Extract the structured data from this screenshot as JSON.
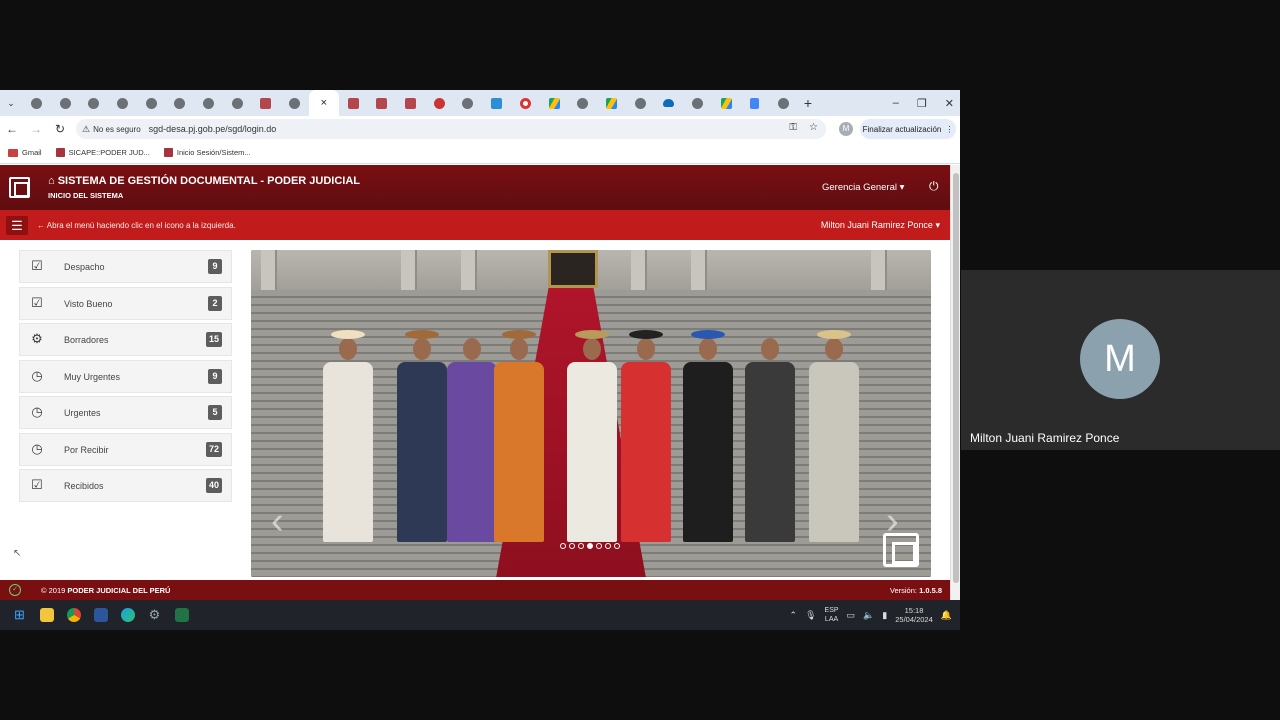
{
  "browser": {
    "tab_count": 27,
    "active_tab_index": 10,
    "active_tab_close": "×",
    "new_tab": "+",
    "window_controls": {
      "minimize": "–",
      "restore": "❐",
      "close": "✕"
    },
    "nav": {
      "back": "←",
      "forward": "→",
      "reload": "↻"
    },
    "address": {
      "security_label": "No es seguro",
      "url": "sgd-desa.pj.gob.pe/sgd/login.do"
    },
    "profile_initial": "M",
    "update_button": "Finalizar actualización",
    "bookmarks": [
      {
        "label": "Gmail",
        "icon": "gmail-icon"
      },
      {
        "label": "SICAPE::PODER JUD...",
        "icon": "pj-icon"
      },
      {
        "label": "Inicio Sesión/Sistem...",
        "icon": "pj-icon"
      }
    ]
  },
  "app": {
    "title": "SISTEMA DE GESTIÓN DOCUMENTAL - PODER JUDICIAL",
    "subtitle": "INICIO DEL SISTEMA",
    "office_menu": "Gerencia General",
    "menu_hint": "Abra el menú haciendo clic en el icono a la izquierda.",
    "user_menu": "Milton Juani Ramirez Ponce",
    "sidebar": [
      {
        "label": "Despacho",
        "count": "9",
        "icon": "check-square-icon"
      },
      {
        "label": "Visto Bueno",
        "count": "2",
        "icon": "check-square-icon"
      },
      {
        "label": "Borradores",
        "count": "15",
        "icon": "gear-icon"
      },
      {
        "label": "Muy Urgentes",
        "count": "9",
        "icon": "clock-icon"
      },
      {
        "label": "Urgentes",
        "count": "5",
        "icon": "clock-icon"
      },
      {
        "label": "Por Recibir",
        "count": "72",
        "icon": "clock-icon"
      },
      {
        "label": "Recibidos",
        "count": "40",
        "icon": "check-square-icon"
      }
    ],
    "carousel": {
      "slide_count": 7,
      "active_slide": 3,
      "prev": "‹",
      "next": "›"
    },
    "footer": {
      "copyright_prefix": "© 2019",
      "copyright_org": "PODER JUDICIAL DEL PERÚ",
      "version_label": "Versión:",
      "version": "1.0.5.8"
    }
  },
  "taskbar": {
    "language": "ESP",
    "layout": "LAA",
    "time": "15:18",
    "date": "25/04/2024"
  },
  "meeting": {
    "participant_initial": "M",
    "participant_name": "Milton Juani Ramirez Ponce"
  }
}
